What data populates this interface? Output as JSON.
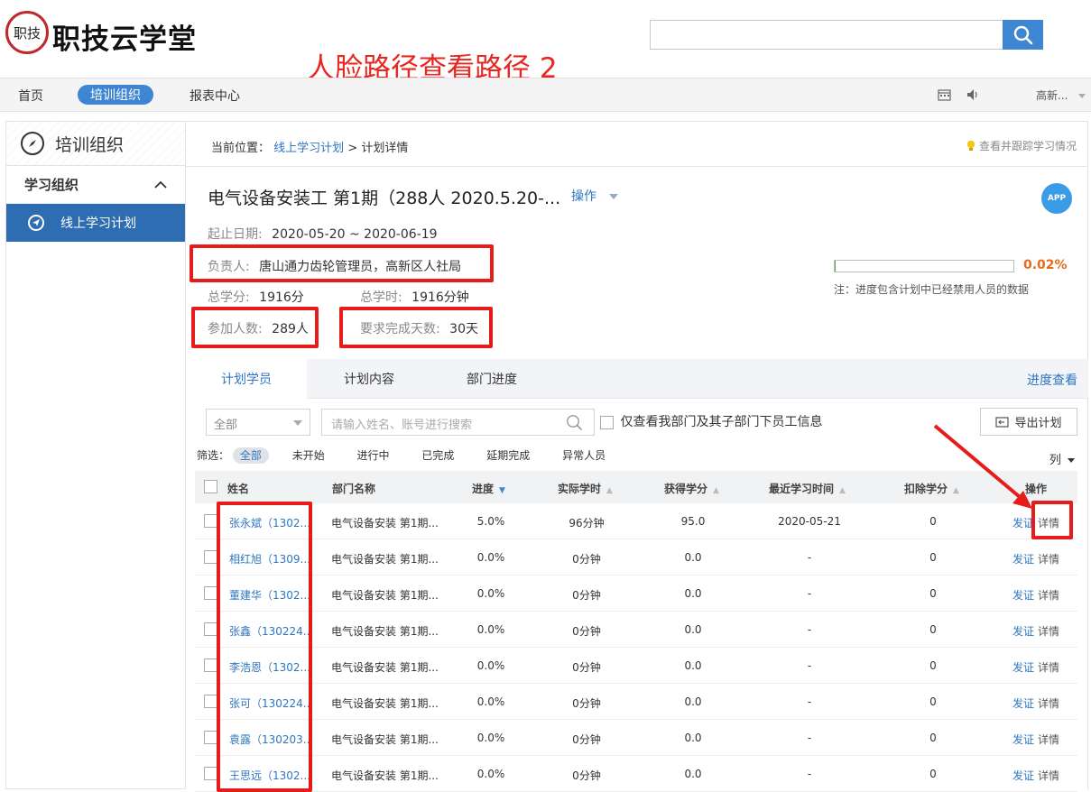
{
  "header": {
    "logo_seal": "职技",
    "logo_text": "职技云学堂",
    "overlay_title": "人脸路径查看路径 2",
    "search_value": ""
  },
  "nav": {
    "items": [
      "首页",
      "培训组织",
      "报表中心"
    ],
    "active_index": 1,
    "user_label": "高新..."
  },
  "sidebar": {
    "title": "培训组织",
    "group": "学习组织",
    "items": [
      "线上学习计划"
    ]
  },
  "breadcrumb": {
    "prefix": "当前位置：",
    "link": "线上学习计划",
    "sep": ">",
    "current": "计划详情"
  },
  "track_link": "查看并跟踪学习情况",
  "plan": {
    "title": "电气设备安装工 第1期（288人 2020.5.20-...",
    "op_label": "操作",
    "app_badge": "APP",
    "date_label": "起止日期:",
    "date_value": "2020-05-20 ~ 2020-06-19",
    "owner_label": "负责人:",
    "owner_value": "唐山通力齿轮管理员，高新区人社局",
    "credits_label": "总学分:",
    "credits_value": "1916分",
    "hours_label": "总学时:",
    "hours_value": "1916分钟",
    "participants_label": "参加人数:",
    "participants_value": "289人",
    "days_label": "要求完成天数:",
    "days_value": "30天",
    "progress_pct": "0.02%",
    "progress_fraction": 0.0002,
    "progress_note": "注：进度包含计划中已经禁用人员的数据"
  },
  "tabs": {
    "items": [
      "计划学员",
      "计划内容",
      "部门进度"
    ],
    "right_link": "进度查看"
  },
  "filters": {
    "scope_select": "全部",
    "search_placeholder": "请输入姓名、账号进行搜索",
    "only_mine": "仅查看我部门及其子部门下员工信息",
    "export": "导出计划",
    "status_prefix": "筛选：",
    "statuses": [
      "全部",
      "未开始",
      "进行中",
      "已完成",
      "延期完成",
      "异常人员"
    ],
    "col_toggle": "列"
  },
  "table": {
    "headers": [
      "姓名",
      "部门名称",
      "进度",
      "实际学时",
      "获得学分",
      "最近学习时间",
      "扣除学分",
      "操作"
    ],
    "rows": [
      {
        "name": "张永斌（1302...",
        "dept": "电气设备安装 第1期...",
        "progress": "5.0%",
        "hours": "96分钟",
        "credits": "95.0",
        "last": "2020-05-21",
        "deduct": "0"
      },
      {
        "name": "相红旭（1309...",
        "dept": "电气设备安装 第1期...",
        "progress": "0.0%",
        "hours": "0分钟",
        "credits": "0.0",
        "last": "-",
        "deduct": "0"
      },
      {
        "name": "董建华（1302...",
        "dept": "电气设备安装 第1期...",
        "progress": "0.0%",
        "hours": "0分钟",
        "credits": "0.0",
        "last": "-",
        "deduct": "0"
      },
      {
        "name": "张鑫（130224...",
        "dept": "电气设备安装 第1期...",
        "progress": "0.0%",
        "hours": "0分钟",
        "credits": "0.0",
        "last": "-",
        "deduct": "0"
      },
      {
        "name": "李浩恩（1302...",
        "dept": "电气设备安装 第1期...",
        "progress": "0.0%",
        "hours": "0分钟",
        "credits": "0.0",
        "last": "-",
        "deduct": "0"
      },
      {
        "name": "张可（130224...",
        "dept": "电气设备安装 第1期...",
        "progress": "0.0%",
        "hours": "0分钟",
        "credits": "0.0",
        "last": "-",
        "deduct": "0"
      },
      {
        "name": "袁露（130203...",
        "dept": "电气设备安装 第1期...",
        "progress": "0.0%",
        "hours": "0分钟",
        "credits": "0.0",
        "last": "-",
        "deduct": "0"
      },
      {
        "name": "王思远（1302...",
        "dept": "电气设备安装 第1期...",
        "progress": "0.0%",
        "hours": "0分钟",
        "credits": "0.0",
        "last": "-",
        "deduct": "0"
      }
    ],
    "action_cert": "发证",
    "action_detail": "详情"
  },
  "colors": {
    "primary": "#3f86d2",
    "sidebar_active": "#2f6db3",
    "link": "#2f75c1",
    "annotation_red": "#e81b1b",
    "progress_pct": "#e66a18"
  }
}
